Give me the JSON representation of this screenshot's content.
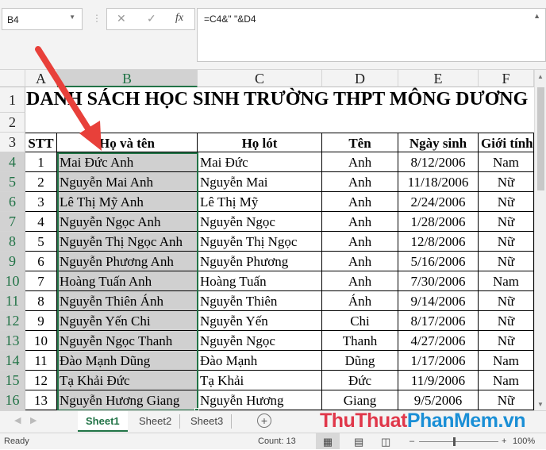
{
  "name_box": "B4",
  "formula": "=C4&\" \"&D4",
  "columns": [
    "A",
    "B",
    "C",
    "D",
    "E",
    "F"
  ],
  "title": "DANH SÁCH HỌC SINH TRƯỜNG THPT MÔNG DƯƠNG",
  "headers": [
    "STT",
    "Họ và tên",
    "Họ lót",
    "Tên",
    "Ngày sinh",
    "Giới tính"
  ],
  "rows": [
    [
      "1",
      "Mai Đức  Anh",
      "Mai Đức",
      "Anh",
      "8/12/2006",
      "Nam"
    ],
    [
      "2",
      "Nguyễn Mai  Anh",
      "Nguyễn Mai",
      "Anh",
      "11/18/2006",
      "Nữ"
    ],
    [
      "3",
      "Lê Thị Mỹ  Anh",
      "Lê Thị Mỹ",
      "Anh",
      "2/24/2006",
      "Nữ"
    ],
    [
      "4",
      "Nguyễn Ngọc  Anh",
      "Nguyễn Ngọc",
      "Anh",
      "1/28/2006",
      "Nữ"
    ],
    [
      "5",
      "Nguyễn Thị Ngọc  Anh",
      "Nguyễn Thị Ngọc",
      "Anh",
      "12/8/2006",
      "Nữ"
    ],
    [
      "6",
      "Nguyễn Phương  Anh",
      "Nguyễn Phương",
      "Anh",
      "5/16/2006",
      "Nữ"
    ],
    [
      "7",
      "Hoàng Tuấn  Anh",
      "Hoàng Tuấn",
      "Anh",
      "7/30/2006",
      "Nam"
    ],
    [
      "8",
      "Nguyễn Thiên  Ánh",
      "Nguyễn Thiên",
      "Ánh",
      "9/14/2006",
      "Nữ"
    ],
    [
      "9",
      "Nguyễn Yến  Chi",
      "Nguyễn Yến",
      "Chi",
      "8/17/2006",
      "Nữ"
    ],
    [
      "10",
      "Nguyễn Ngọc  Thanh",
      "Nguyễn Ngọc",
      "Thanh",
      "4/27/2006",
      "Nữ"
    ],
    [
      "11",
      "Đào Mạnh  Dũng",
      "Đào Mạnh",
      "Dũng",
      "1/17/2006",
      "Nam"
    ],
    [
      "12",
      "Tạ Khải  Đức",
      "Tạ Khải",
      "Đức",
      "11/9/2006",
      "Nam"
    ],
    [
      "13",
      "Nguyễn Hương  Giang",
      "Nguyễn Hương",
      "Giang",
      "9/5/2006",
      "Nữ"
    ]
  ],
  "sheets": [
    "Sheet1",
    "Sheet2",
    "Sheet3"
  ],
  "status": {
    "ready": "Ready",
    "count": "Count: 13",
    "zoom": "100%"
  },
  "watermark": {
    "part1": "ThuThuat",
    "part2": "PhanMem",
    "part3": ".vn"
  },
  "colors": {
    "accent": "#217346",
    "arrow": "#e8403a"
  }
}
